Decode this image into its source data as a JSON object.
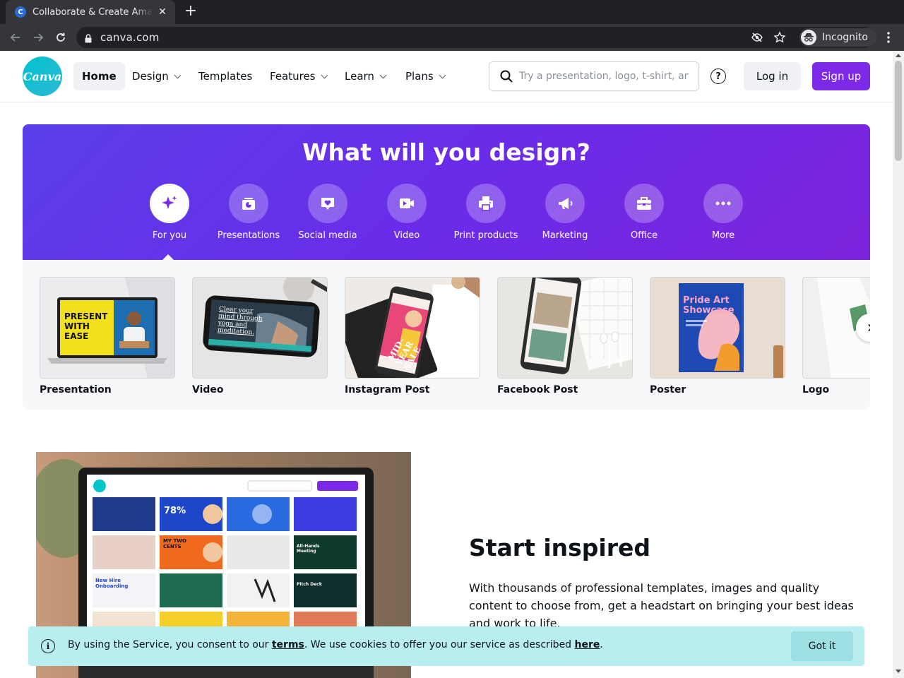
{
  "browser": {
    "tab_title": "Collaborate & Create Amazing Graphic Design for Free",
    "favicon_letter": "C",
    "tab_close_icon": "close-icon",
    "new_tab_label": "+",
    "url": "canva.com",
    "incognito_label": "Incognito"
  },
  "header": {
    "logo_text": "Canva",
    "nav": [
      {
        "label": "Home"
      },
      {
        "label": "Design"
      },
      {
        "label": "Templates"
      },
      {
        "label": "Features"
      },
      {
        "label": "Learn"
      },
      {
        "label": "Plans"
      }
    ],
    "search_placeholder": "Try a presentation, logo, t-shirt, anything",
    "help_glyph": "?",
    "login_label": "Log in",
    "signup_label": "Sign up"
  },
  "hero": {
    "title": "What will you design?",
    "categories": [
      {
        "label": "For you",
        "icon": "sparkle-icon"
      },
      {
        "label": "Presentations",
        "icon": "presentation-icon"
      },
      {
        "label": "Social media",
        "icon": "heart-icon"
      },
      {
        "label": "Video",
        "icon": "video-icon"
      },
      {
        "label": "Print products",
        "icon": "printer-icon"
      },
      {
        "label": "Marketing",
        "icon": "megaphone-icon"
      },
      {
        "label": "Office",
        "icon": "briefcase-icon"
      },
      {
        "label": "More",
        "icon": "more-icon"
      }
    ]
  },
  "templates": [
    {
      "label": "Presentation",
      "thumb_text": "PRESENT WITH EASE"
    },
    {
      "label": "Video",
      "thumb_text": "Clear your mind through yoga and meditation."
    },
    {
      "label": "Instagram Post",
      "thumb_text": "MID-YEAR SALE"
    },
    {
      "label": "Facebook Post",
      "thumb_text": ""
    },
    {
      "label": "Poster",
      "thumb_text": "Pride Art Showcase"
    },
    {
      "label": "Logo",
      "thumb_text": ""
    }
  ],
  "inspired": {
    "title": "Start inspired",
    "body": "With thousands of professional templates, images and quality content to choose from, get a headstart on bringing your best ideas and work to life.",
    "screen_tiles": [
      "78%",
      "All-Hands Meeting",
      "New Hire Onboarding",
      "Pitch Deck",
      "MY TWO CENTS"
    ]
  },
  "cookie": {
    "text_before": "By using the Service, you consent to our ",
    "terms_link": "terms",
    "text_middle": ". We use cookies to offer you our service as described ",
    "here_link": "here",
    "text_after": ".",
    "button_label": "Got it"
  },
  "colors": {
    "brand_purple": "#7d2ae8",
    "brand_teal": "#00c4cc",
    "cookie_bg": "#b8eef0"
  }
}
